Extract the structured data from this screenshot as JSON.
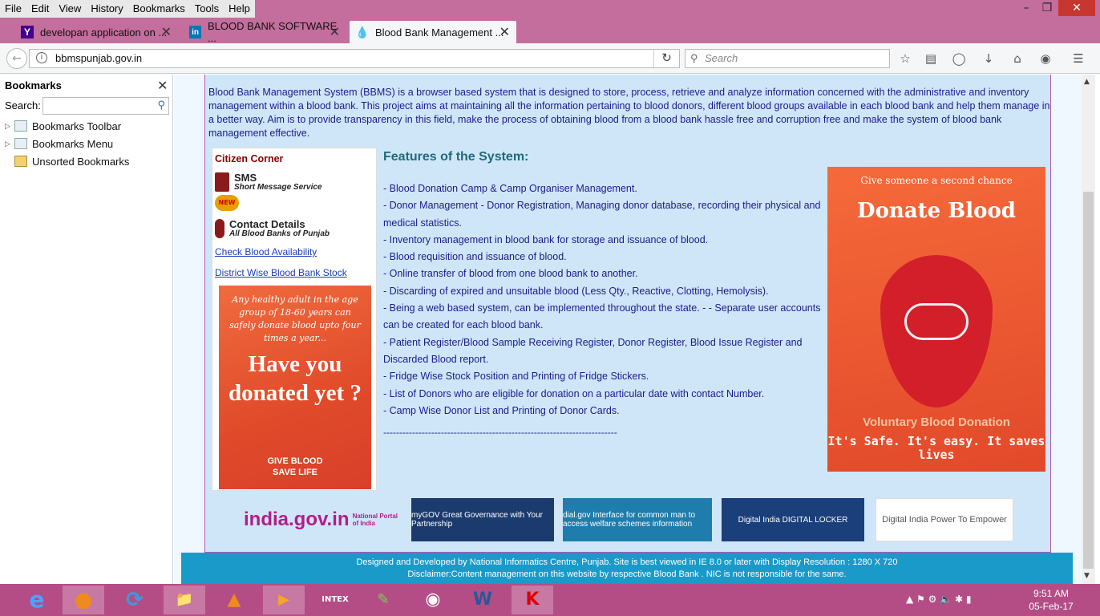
{
  "menu": [
    "File",
    "Edit",
    "View",
    "History",
    "Bookmarks",
    "Tools",
    "Help"
  ],
  "tabs": [
    {
      "label": "developan application on ...",
      "icon": "Y",
      "icon_color": "#400090"
    },
    {
      "label": "BLOOD BANK SOFTWARE ...",
      "icon": "in",
      "icon_color": "#0077b5"
    },
    {
      "label": "Blood Bank Management ...",
      "icon": "drop",
      "icon_color": "#c00000"
    }
  ],
  "url": "bbmspunjab.gov.in",
  "search_placeholder": "Search",
  "sidebar": {
    "title": "Bookmarks",
    "search_label": "Search:",
    "items": [
      "Bookmarks Toolbar",
      "Bookmarks Menu",
      "Unsorted Bookmarks"
    ]
  },
  "intro": "Blood Bank Management System (BBMS) is a browser based system that is designed to store, process, retrieve and analyze information concerned with the administrative and inventory management within a blood bank. This project aims at maintaining all the information pertaining to blood donors, different blood groups available in each blood bank and help them manage in a better way. Aim is to provide transparency in this field, make the process of obtaining blood from a blood bank hassle free and corruption free and make the system of blood bank management effective.",
  "citizen": {
    "title": "Citizen Corner",
    "sms_title": "SMS",
    "sms_sub": "Short Message Service",
    "new_badge": "NEW",
    "contact_title": "Contact Details",
    "contact_sub": "All Blood Banks of Punjab",
    "link1": "Check Blood Availability",
    "link2": "District Wise Blood Bank Stock",
    "poster_text1": "Any healthy adult in the age group of 18-60 years can safely donate blood upto four times a year...",
    "poster_text2": "Have you donated yet ?",
    "poster_text3": "GIVE BLOOD SAVE LIFE"
  },
  "features_title": "Features of the System:",
  "features": [
    "- Blood Donation Camp & Camp Organiser Management.",
    "- Donor Management - Donor Registration, Managing donor database, recording their physical and medical statistics.",
    "- Inventory management in blood bank for storage and issuance of blood.",
    "- Blood requisition and issuance of blood.",
    "- Online transfer of blood from one blood bank to another.",
    "- Discarding of expired and unsuitable blood (Less Qty., Reactive, Clotting, Hemolysis).",
    "- Being a web based system, can be implemented throughout the state. - - Separate user accounts can be created for each blood bank.",
    "- Patient Register/Blood Sample Receiving Register, Donor Register, Blood Issue Register and Discarded Blood report.",
    "- Fridge Wise Stock Position and Printing of Fridge Stickers.",
    "- List of Donors who are eligible for donation on a particular date with contact Number.",
    "- Camp Wise Donor List and Printing of Donor Cards."
  ],
  "dashes": "-------------------------------------------------------------------------",
  "donate": {
    "line1": "Give someone a second chance",
    "line2": "Donate Blood",
    "line3": "Voluntary Blood Donation",
    "line4": "It's Safe. It's easy. It saves lives"
  },
  "banners": {
    "india": "india.gov.in",
    "india_sub": "National Portal of India",
    "mygov": "myGOV  Great Governance with Your Partnership",
    "dialgov": "dial.gov  Interface for common man to access welfare schemes information",
    "digilocker": "Digital India  DIGITAL LOCKER",
    "digitalindia": "Digital India  Power To Empower"
  },
  "footer": {
    "line1": "Designed and Developed by National Informatics Centre, Punjab. Site is best viewed in IE 8.0 or later with Display Resolution : 1280 X 720",
    "line2": "Disclaimer:Content management on this website by respective Blood Bank . NIC is not responsible for the same."
  },
  "taskbar": {
    "intex_label": "INTEX",
    "time": "9:51 AM",
    "date": "05-Feb-17"
  }
}
